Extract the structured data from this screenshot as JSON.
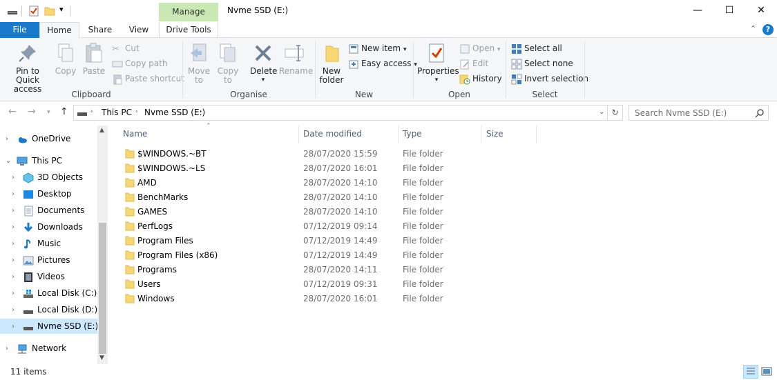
{
  "window": {
    "title": "Nvme SSD (E:)",
    "context_tab_group": "Manage",
    "minimize": "—",
    "maximize": "☐",
    "close": "✕"
  },
  "ribbon_tabs": {
    "file": "File",
    "home": "Home",
    "share": "Share",
    "view": "View",
    "drive_tools": "Drive Tools"
  },
  "ribbon": {
    "clipboard": {
      "label": "Clipboard",
      "pin_line1": "Pin to Quick",
      "pin_line2": "access",
      "copy": "Copy",
      "paste": "Paste",
      "cut": "Cut",
      "copy_path": "Copy path",
      "paste_shortcut": "Paste shortcut"
    },
    "organise": {
      "label": "Organise",
      "move_to_line1": "Move",
      "move_to_line2": "to",
      "copy_to_line1": "Copy",
      "copy_to_line2": "to",
      "delete": "Delete",
      "rename": "Rename"
    },
    "new": {
      "label": "New",
      "new_folder_line1": "New",
      "new_folder_line2": "folder",
      "new_item": "New item",
      "easy_access": "Easy access"
    },
    "open": {
      "label": "Open",
      "properties": "Properties",
      "open": "Open",
      "edit": "Edit",
      "history": "History"
    },
    "select": {
      "label": "Select",
      "select_all": "Select all",
      "select_none": "Select none",
      "invert_selection": "Invert selection"
    }
  },
  "address": {
    "crumb1": "This PC",
    "crumb2": "Nvme SSD (E:)",
    "search_placeholder": "Search Nvme SSD (E:)"
  },
  "nav": {
    "onedrive": "OneDrive",
    "this_pc": "This PC",
    "objects3d": "3D Objects",
    "desktop": "Desktop",
    "documents": "Documents",
    "downloads": "Downloads",
    "music": "Music",
    "pictures": "Pictures",
    "videos": "Videos",
    "local_c": "Local Disk (C:)",
    "local_d": "Local Disk (D:)",
    "nvme_e": "Nvme SSD (E:)",
    "network": "Network"
  },
  "columns": {
    "name": "Name",
    "date": "Date modified",
    "type": "Type",
    "size": "Size"
  },
  "files": [
    {
      "name": "$WINDOWS.~BT",
      "date": "28/07/2020 15:59",
      "type": "File folder"
    },
    {
      "name": "$WINDOWS.~LS",
      "date": "28/07/2020 16:01",
      "type": "File folder"
    },
    {
      "name": "AMD",
      "date": "28/07/2020 14:10",
      "type": "File folder"
    },
    {
      "name": "BenchMarks",
      "date": "28/07/2020 14:10",
      "type": "File folder"
    },
    {
      "name": "GAMES",
      "date": "28/07/2020 14:10",
      "type": "File folder"
    },
    {
      "name": "PerfLogs",
      "date": "07/12/2019 09:14",
      "type": "File folder"
    },
    {
      "name": "Program Files",
      "date": "07/12/2019 14:49",
      "type": "File folder"
    },
    {
      "name": "Program Files (x86)",
      "date": "07/12/2019 14:49",
      "type": "File folder"
    },
    {
      "name": "Programs",
      "date": "28/07/2020 14:11",
      "type": "File folder"
    },
    {
      "name": "Users",
      "date": "07/12/2019 09:31",
      "type": "File folder"
    },
    {
      "name": "Windows",
      "date": "28/07/2020 16:01",
      "type": "File folder"
    }
  ],
  "status": {
    "item_count": "11 items"
  },
  "colors": {
    "accent": "#1979ca",
    "manage_tab": "#c9e8b4",
    "selection": "#cce8ff",
    "folder": "#f8d775"
  }
}
